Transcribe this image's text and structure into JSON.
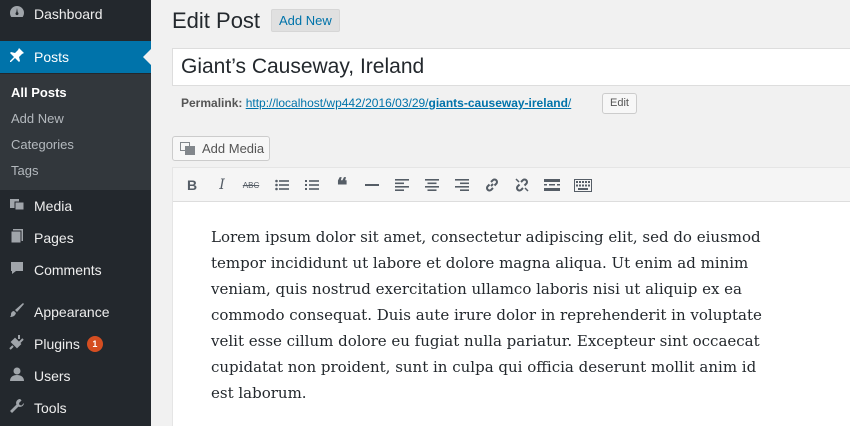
{
  "sidebar": {
    "items": [
      {
        "label": "Dashboard",
        "icon": "dashboard-icon"
      },
      {
        "label": "Posts",
        "icon": "pin-icon"
      },
      {
        "label": "Media",
        "icon": "media-icon"
      },
      {
        "label": "Pages",
        "icon": "pages-icon"
      },
      {
        "label": "Comments",
        "icon": "comments-icon"
      },
      {
        "label": "Appearance",
        "icon": "brush-icon"
      },
      {
        "label": "Plugins",
        "icon": "plug-icon",
        "badge": "1"
      },
      {
        "label": "Users",
        "icon": "user-icon"
      },
      {
        "label": "Tools",
        "icon": "wrench-icon"
      }
    ],
    "submenu": [
      {
        "label": "All Posts",
        "current": true
      },
      {
        "label": "Add New"
      },
      {
        "label": "Categories"
      },
      {
        "label": "Tags"
      }
    ]
  },
  "header": {
    "title": "Edit Post",
    "add_new": "Add New"
  },
  "post": {
    "title": "Giant’s Causeway, Ireland",
    "permalink_label": "Permalink:",
    "permalink_base": "http://localhost/wp442/2016/03/29/",
    "permalink_slug": "giants-causeway-ireland",
    "permalink_end": "/",
    "edit_label": "Edit",
    "add_media": "Add Media",
    "content": "Lorem ipsum dolor sit amet, consectetur adipiscing elit, sed do eiusmod tempor incididunt ut labore et dolore magna aliqua. Ut enim ad minim veniam, quis nostrud exercitation ullamco laboris nisi ut aliquip ex ea commodo consequat. Duis aute irure dolor in reprehenderit in voluptate velit esse cillum dolore eu fugiat nulla pariatur. Excepteur sint occaecat cupidatat non proident, sunt in culpa qui officia deserunt mollit anim id est laborum."
  },
  "toolbar": {
    "bold": "B",
    "italic": "I",
    "strike": "ABC",
    "blockquote": "❝"
  },
  "colors": {
    "sidebar_bg": "#23282d",
    "active_bg": "#0073aa",
    "link": "#0073aa",
    "badge": "#d54e21"
  }
}
